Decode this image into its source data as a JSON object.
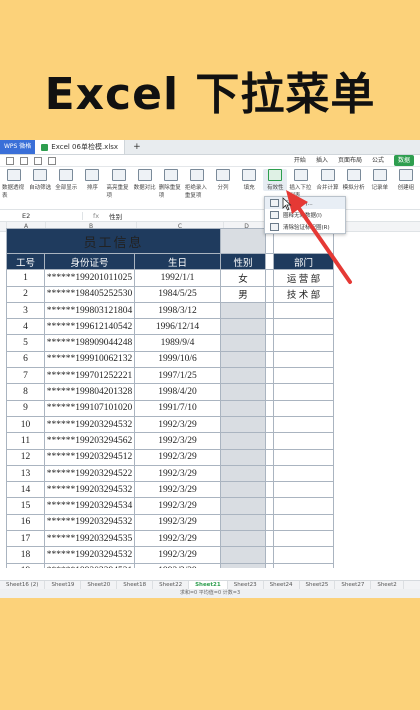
{
  "headline": "Excel 下拉菜单",
  "window": {
    "app_tab": "WPS 微格",
    "file_tab": "Excel 06单检模.xlsx",
    "new_tab": "+"
  },
  "menus": [
    "开始",
    "插入",
    "页面布局",
    "公式",
    "数据"
  ],
  "ribbon": [
    "数据透视表",
    "自动筛选",
    "全部显示",
    "排序",
    "高亮重复项",
    "数据对比",
    "删除重复项",
    "拒绝录入重复项",
    "分列",
    "填充",
    "有效性",
    "插入下拉列表",
    "合并计算",
    "模拟分析",
    "记录单",
    "创建组"
  ],
  "dropdown": {
    "items": [
      "有效性(V)...",
      "圈释无效数据(I)",
      "清除验证标识圈(R)"
    ]
  },
  "namebox": {
    "cell": "E2",
    "formula": "性别"
  },
  "columns": [
    "A",
    "B",
    "C",
    "D",
    "E",
    "F"
  ],
  "table": {
    "title": "员工信息",
    "headers": {
      "id": "工号",
      "idcard": "身份证号",
      "birthday": "生日",
      "gender": "性别",
      "dept": "部门"
    },
    "rows": [
      {
        "id": "1",
        "idcard": "******199201011025",
        "birthday": "1992/1/1",
        "gender": "女",
        "dept": "运 营 部"
      },
      {
        "id": "2",
        "idcard": "******198405252530",
        "birthday": "1984/5/25",
        "gender": "男",
        "dept": "技 术 部"
      },
      {
        "id": "3",
        "idcard": "******199803121804",
        "birthday": "1998/3/12",
        "gender": "",
        "dept": ""
      },
      {
        "id": "4",
        "idcard": "******199612140542",
        "birthday": "1996/12/14",
        "gender": "",
        "dept": ""
      },
      {
        "id": "5",
        "idcard": "******198909044248",
        "birthday": "1989/9/4",
        "gender": "",
        "dept": ""
      },
      {
        "id": "6",
        "idcard": "******199910062132",
        "birthday": "1999/10/6",
        "gender": "",
        "dept": ""
      },
      {
        "id": "7",
        "idcard": "******199701252221",
        "birthday": "1997/1/25",
        "gender": "",
        "dept": ""
      },
      {
        "id": "8",
        "idcard": "******199804201328",
        "birthday": "1998/4/20",
        "gender": "",
        "dept": ""
      },
      {
        "id": "9",
        "idcard": "******199107101020",
        "birthday": "1991/7/10",
        "gender": "",
        "dept": ""
      },
      {
        "id": "10",
        "idcard": "******199203294532",
        "birthday": "1992/3/29",
        "gender": "",
        "dept": ""
      },
      {
        "id": "11",
        "idcard": "******199203294562",
        "birthday": "1992/3/29",
        "gender": "",
        "dept": ""
      },
      {
        "id": "12",
        "idcard": "******199203294512",
        "birthday": "1992/3/29",
        "gender": "",
        "dept": ""
      },
      {
        "id": "13",
        "idcard": "******199203294522",
        "birthday": "1992/3/29",
        "gender": "",
        "dept": ""
      },
      {
        "id": "14",
        "idcard": "******199203294532",
        "birthday": "1992/3/29",
        "gender": "",
        "dept": ""
      },
      {
        "id": "15",
        "idcard": "******199203294534",
        "birthday": "1992/3/29",
        "gender": "",
        "dept": ""
      },
      {
        "id": "16",
        "idcard": "******199203294532",
        "birthday": "1992/3/29",
        "gender": "",
        "dept": ""
      },
      {
        "id": "17",
        "idcard": "******199203294535",
        "birthday": "1992/3/29",
        "gender": "",
        "dept": ""
      },
      {
        "id": "18",
        "idcard": "******199203294532",
        "birthday": "1992/3/29",
        "gender": "",
        "dept": ""
      },
      {
        "id": "19",
        "idcard": "******199203294521",
        "birthday": "1992/3/29",
        "gender": "",
        "dept": ""
      }
    ]
  },
  "sheet_tabs": [
    "Sheet16 (2)",
    "Sheet19",
    "Sheet20",
    "Sheet18",
    "Sheet22",
    "Sheet21",
    "Sheet23",
    "Sheet24",
    "Sheet25",
    "Sheet27",
    "Sheet2"
  ],
  "active_sheet": "Sheet21",
  "status": "求和=0  平均值=0  计数=3",
  "colors": {
    "header_bg": "#1f3b5e",
    "accent": "#2e9e4f",
    "arrow": "#e53935",
    "background": "#fcd27a"
  }
}
